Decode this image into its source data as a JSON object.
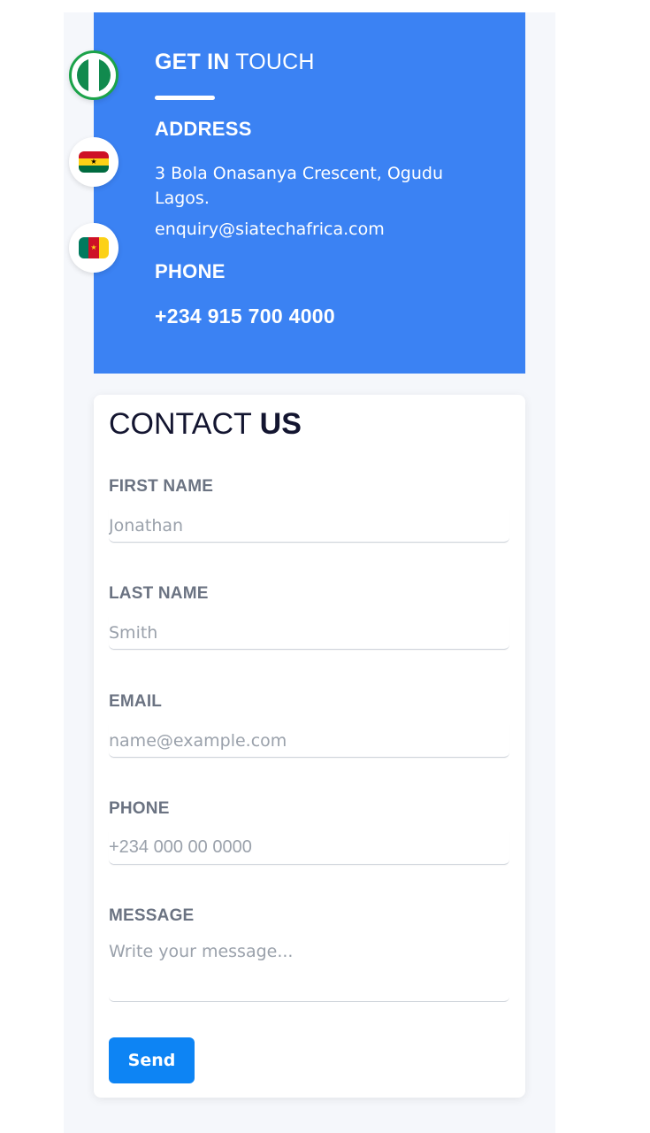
{
  "info": {
    "title_strong": "GET IN",
    "title_light": "TOUCH",
    "address_label": "ADDRESS",
    "address_text": "3 Bola Onasanya Crescent, Ogudu Lagos.",
    "email": "enquiry@siatechafrica.com",
    "phone_label": "PHONE",
    "phone_number": "+234 915 700 4000",
    "background_color": "#3b82f3"
  },
  "flags": [
    {
      "icon": "nigeria-flag-icon",
      "active": true
    },
    {
      "icon": "ghana-flag-icon",
      "active": false
    },
    {
      "icon": "cameroon-flag-icon",
      "active": false
    }
  ],
  "contact": {
    "title_light": "CONTACT",
    "title_strong": "US",
    "fields": {
      "first_name": {
        "label": "FIRST NAME",
        "placeholder": "Jonathan"
      },
      "last_name": {
        "label": "LAST NAME",
        "placeholder": "Smith"
      },
      "email": {
        "label": "EMAIL",
        "placeholder": "name@example.com"
      },
      "phone": {
        "label": "PHONE",
        "placeholder": "+234 000 00 0000"
      },
      "message": {
        "label": "MESSAGE",
        "placeholder": "Write your message..."
      }
    },
    "send_label": "Send",
    "button_color": "#0d84f4"
  }
}
